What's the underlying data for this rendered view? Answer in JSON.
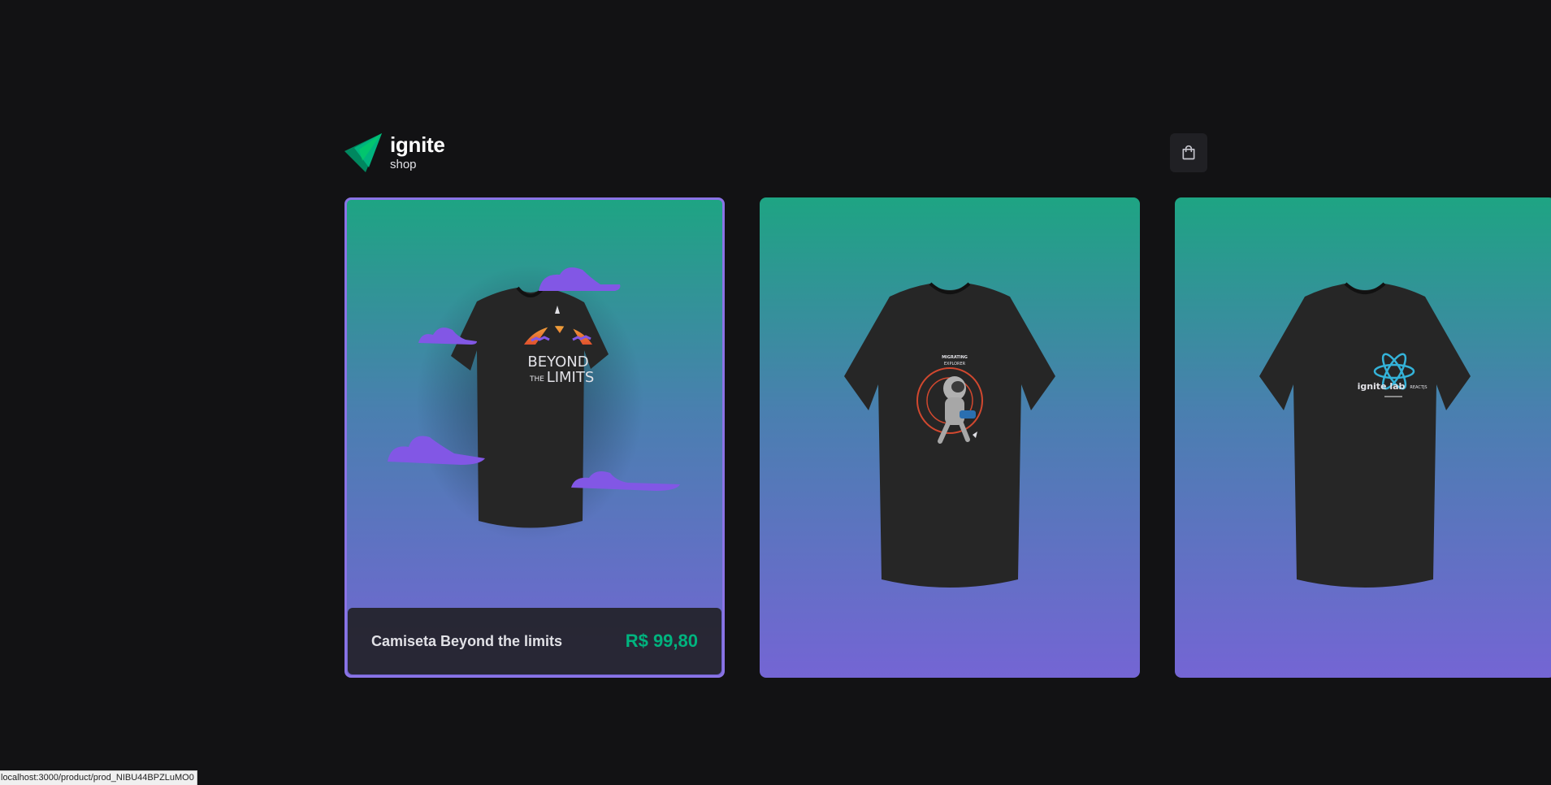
{
  "header": {
    "logo_title": "ignite",
    "logo_subtitle": "shop",
    "cart_icon": "shopping-bag-icon"
  },
  "products": [
    {
      "name": "Camiseta Beyond the limits",
      "price": "R$ 99,80",
      "print_lines": [
        "BEYOND",
        "THE",
        "LIMITS"
      ]
    },
    {
      "print_lines": [
        "MIGRATING",
        "EXPLORER"
      ]
    },
    {
      "print_lines": [
        "ignite lab",
        "REACTJS"
      ]
    }
  ],
  "status_bar": {
    "url": "localhost:3000/product/prod_NIBU44BPZLuMO0"
  },
  "colors": {
    "background": "#121214",
    "accent_green": "#00b37e",
    "card_gradient_top": "#1ea483",
    "card_gradient_bottom": "#7465d4",
    "hover_border": "#8a73e6"
  }
}
